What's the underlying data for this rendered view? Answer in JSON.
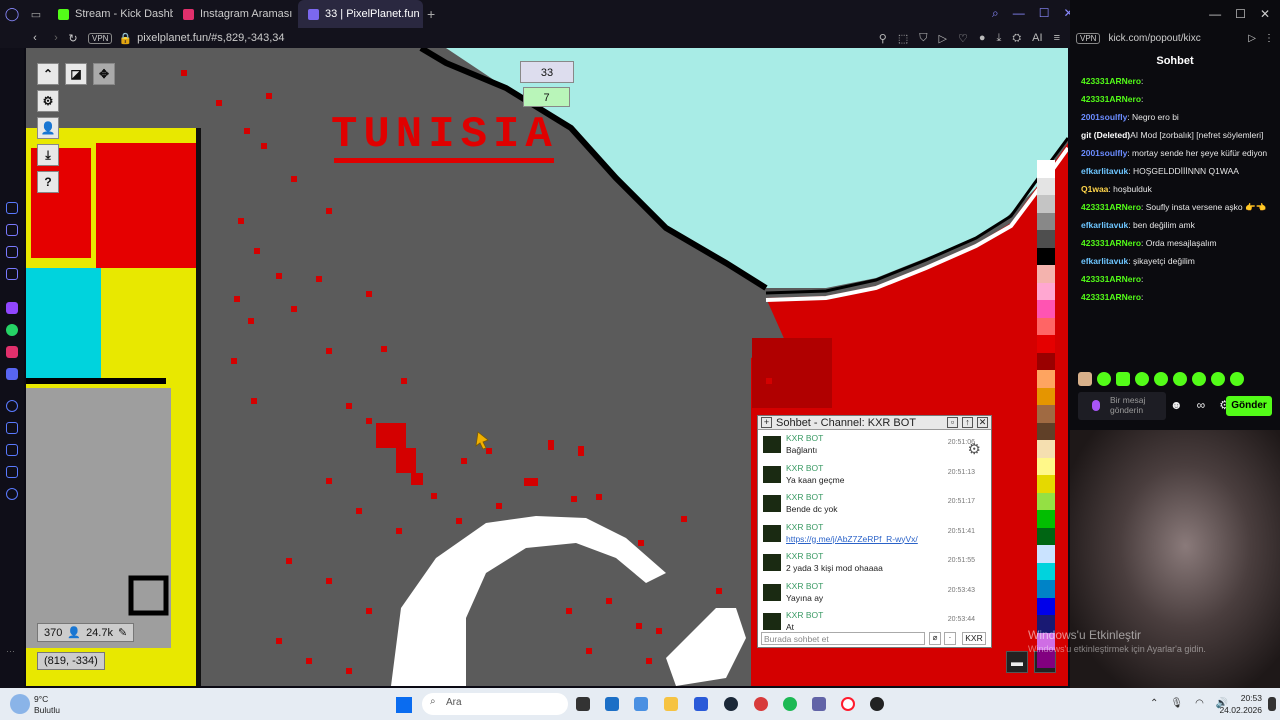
{
  "browser": {
    "tabs": [
      {
        "label": "Stream - Kick Dashboard",
        "color": "#53fc18",
        "active": false
      },
      {
        "label": "Instagram Araması",
        "color": "#e1306c",
        "active": false
      },
      {
        "label": "33 | PixelPlanet.fun",
        "color": "#7b68ee",
        "active": true
      }
    ],
    "url": "pixelplanet.fun/#s,829,-343,34",
    "vpn": "VPN",
    "ai_label": "AI"
  },
  "popout": {
    "url": "kick.com/popout/kixc",
    "vpn": "VPN",
    "chat_title": "Sohbet",
    "messages": [
      {
        "user": "423331ARNero",
        "color": "#53fc18",
        "text": ":"
      },
      {
        "user": "423331ARNero",
        "color": "#53fc18",
        "text": ":"
      },
      {
        "user": "2001soulfly",
        "color": "#6b8cff",
        "text": ": Negro ero bi"
      },
      {
        "user": "git (Deleted)",
        "color": "#ffffff",
        "text": "AI Mod [zorbalık] [nefret söylemleri]"
      },
      {
        "user": "2001soulfly",
        "color": "#6b8cff",
        "text": ": mortay sende her şeye küfür ediyon"
      },
      {
        "user": "efkarlitavuk",
        "color": "#6ec6ff",
        "text": ": HOŞGELDDİİİNNN Q1WAA"
      },
      {
        "user": "Q1waa",
        "color": "#ffd54a",
        "text": ": hoşbulduk"
      },
      {
        "user": "423331ARNero",
        "color": "#53fc18",
        "text": ": Soufly insta versene aşko 👉👈"
      },
      {
        "user": "efkarlitavuk",
        "color": "#6ec6ff",
        "text": ": ben değilim amk"
      },
      {
        "user": "423331ARNero",
        "color": "#53fc18",
        "text": ": Orda mesajlaşalım"
      },
      {
        "user": "efkarlitavuk",
        "color": "#6ec6ff",
        "text": ": şikayetçi değilim"
      },
      {
        "user": "423331ARNero",
        "color": "#53fc18",
        "text": ":"
      },
      {
        "user": "423331ARNero",
        "color": "#53fc18",
        "text": ":"
      }
    ],
    "input_placeholder": "Bir mesaj gönderin",
    "send_label": "Gönder",
    "watermark_title": "Windows'u Etkinleştir",
    "watermark_sub": "Windows'u etkinleştirmek için Ayarlar'a gidin."
  },
  "canvas": {
    "counter_top": "33",
    "counter_bottom": "7",
    "tunisia_text": "TUNISIA",
    "online_count": "370",
    "pixel_count": "24.7k",
    "coords": "(819, -334)"
  },
  "overlay_chat": {
    "title": "Sohbet - Channel: KXR BOT",
    "messages": [
      {
        "user": "KXR BOT",
        "text": "Bağlantı",
        "time": "20:51:06",
        "link": false
      },
      {
        "user": "KXR BOT",
        "text": "Ya kaan geçme",
        "time": "20:51:13",
        "link": false
      },
      {
        "user": "KXR BOT",
        "text": "Bende dc yok",
        "time": "20:51:17",
        "link": false
      },
      {
        "user": "KXR BOT",
        "text": "https://g.me/j/AbZ7ZeRPf_R-wyVx/",
        "time": "20:51:41",
        "link": true
      },
      {
        "user": "KXR BOT",
        "text": "2 yada 3 kişi mod ohaaaa",
        "time": "20:51:55",
        "link": false
      },
      {
        "user": "KXR BOT",
        "text": "Yayına ay",
        "time": "20:53:43",
        "link": false
      },
      {
        "user": "KXR BOT",
        "text": "At",
        "time": "20:53:44",
        "link": false
      }
    ],
    "input_placeholder": "Burada sohbet et",
    "channel_button": "KXR"
  },
  "taskbar": {
    "weather_temp": "9°C",
    "weather_text": "Bulutlu",
    "search_placeholder": "Ara",
    "time": "20:53",
    "date": "24.02.2026"
  },
  "palette": [
    "#ffffff",
    "#e4e4e4",
    "#c4c4c4",
    "#888888",
    "#4e4e4e",
    "#000000",
    "#f4b3ae",
    "#ffa7d1",
    "#ff54b2",
    "#ff6565",
    "#e50000",
    "#9a0000",
    "#fea460",
    "#e59500",
    "#a06a42",
    "#604028",
    "#f5dfb0",
    "#fff889",
    "#e5d900",
    "#94e044",
    "#02be01",
    "#006513",
    "#cae3ff",
    "#00d3dd",
    "#0083c7",
    "#0000ea",
    "#191973",
    "#cf6ee4",
    "#820080"
  ]
}
